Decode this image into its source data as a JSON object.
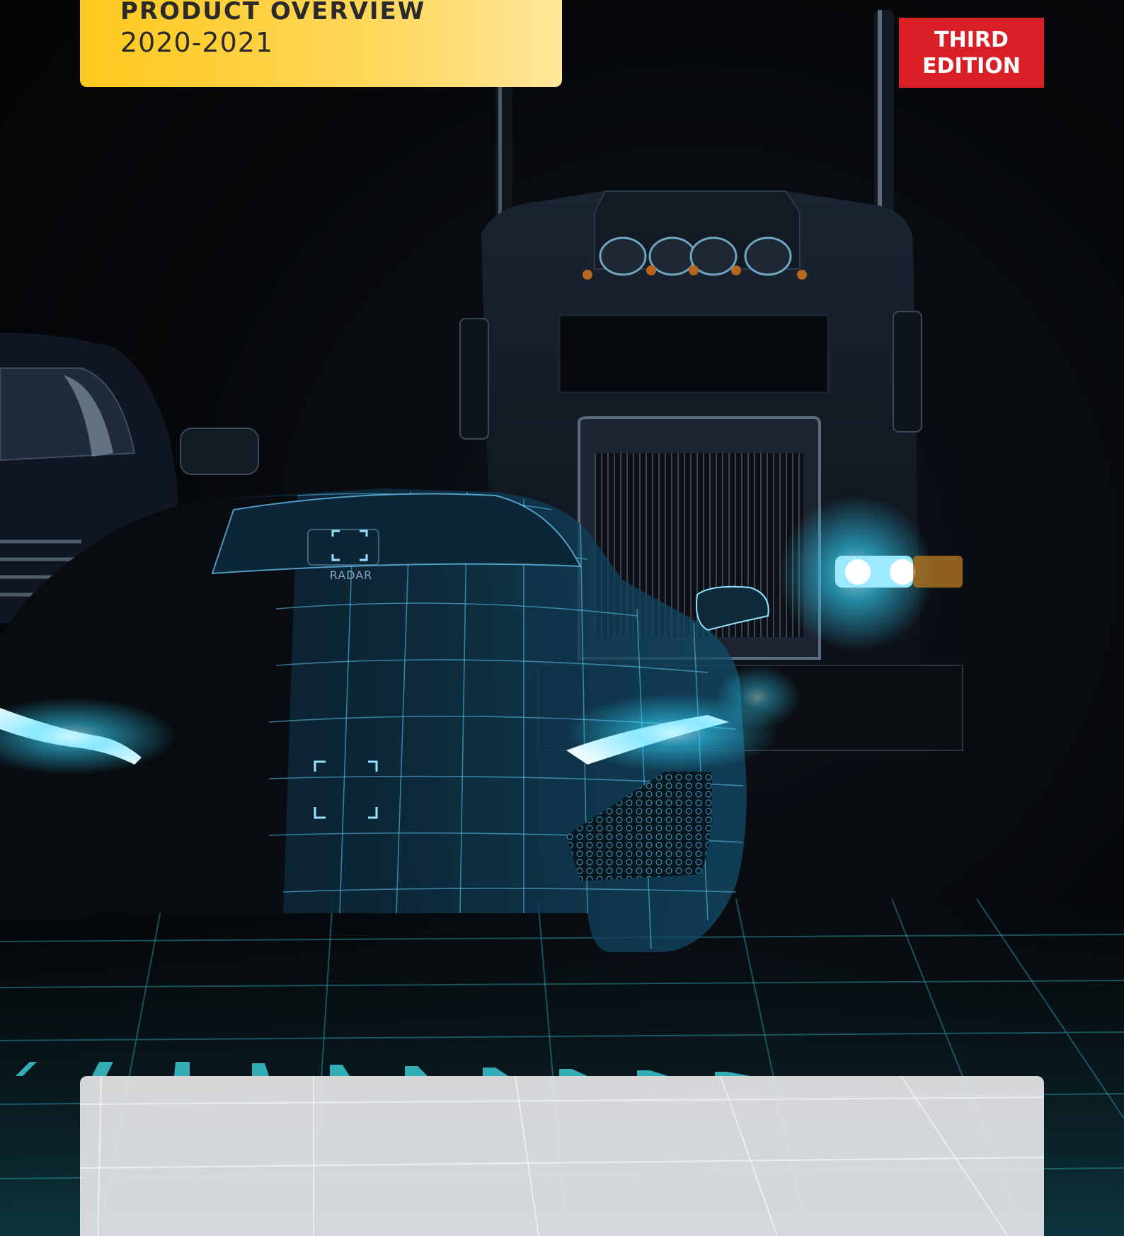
{
  "cover": {
    "title": "PRODUCT OVERVIEW",
    "years": "2020-2021",
    "edition_line1": "THIRD",
    "edition_line2": "EDITION",
    "radar_label": "RADAR"
  },
  "colors": {
    "title_box": "#ffc81c",
    "edition_badge": "#d91f26",
    "glow": "#35d7ff",
    "background": "#050608"
  }
}
